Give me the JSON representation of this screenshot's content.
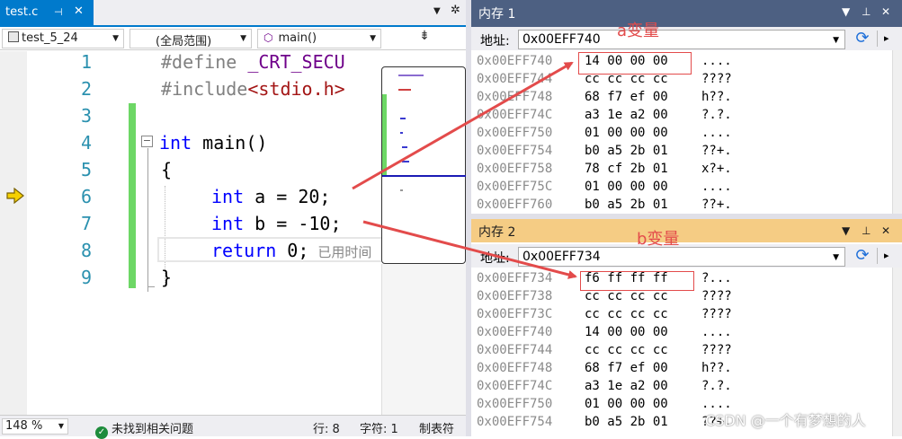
{
  "editor": {
    "tab_label": "test.c",
    "tab_pin": "⊣",
    "tab_close": "✕",
    "nav_project": "test_5_24",
    "nav_scope": "(全局范围)",
    "nav_function": "main()",
    "lines": [
      "1",
      "2",
      "3",
      "4",
      "5",
      "6",
      "7",
      "8",
      "9"
    ],
    "code": {
      "l1_a": "#define ",
      "l1_b": "_CRT_SECU",
      "l2_a": "#include",
      "l2_b": "<stdio.h>",
      "l4_kw": "int",
      "l4_rest": " main()",
      "l5": "{",
      "l6_kw": "int",
      "l6_rest": " a = 20;",
      "l7_kw": "int",
      "l7_rest": " b = -10;",
      "l8_kw": "return",
      "l8_rest": " 0;",
      "l8_hint": "已用时间",
      "l9": "}"
    },
    "collapse_glyph": "−"
  },
  "status": {
    "zoom": "148 %",
    "issues": "未找到相关问题",
    "issues_glyph": "✓",
    "row": "行: 8",
    "col": "字符: 1",
    "tabs": "制表符"
  },
  "memory1": {
    "title": "内存 1",
    "address_label": "地址:",
    "address": "0x00EFF740",
    "rows": [
      {
        "addr": "0x00EFF740",
        "bytes": "14 00 00 00",
        "ascii": "...."
      },
      {
        "addr": "0x00EFF744",
        "bytes": "cc cc cc cc",
        "ascii": "????"
      },
      {
        "addr": "0x00EFF748",
        "bytes": "68 f7 ef 00",
        "ascii": "h??."
      },
      {
        "addr": "0x00EFF74C",
        "bytes": "a3 1e a2 00",
        "ascii": "?.?."
      },
      {
        "addr": "0x00EFF750",
        "bytes": "01 00 00 00",
        "ascii": "...."
      },
      {
        "addr": "0x00EFF754",
        "bytes": "b0 a5 2b 01",
        "ascii": "??+."
      },
      {
        "addr": "0x00EFF758",
        "bytes": "78 cf 2b 01",
        "ascii": "x?+."
      },
      {
        "addr": "0x00EFF75C",
        "bytes": "01 00 00 00",
        "ascii": "...."
      },
      {
        "addr": "0x00EFF760",
        "bytes": "b0 a5 2b 01",
        "ascii": "??+."
      }
    ],
    "annotation": "a变量"
  },
  "memory2": {
    "title": "内存 2",
    "address_label": "地址:",
    "address": "0x00EFF734",
    "rows": [
      {
        "addr": "0x00EFF734",
        "bytes": "f6 ff ff ff",
        "ascii": "?..."
      },
      {
        "addr": "0x00EFF738",
        "bytes": "cc cc cc cc",
        "ascii": "????"
      },
      {
        "addr": "0x00EFF73C",
        "bytes": "cc cc cc cc",
        "ascii": "????"
      },
      {
        "addr": "0x00EFF740",
        "bytes": "14 00 00 00",
        "ascii": "...."
      },
      {
        "addr": "0x00EFF744",
        "bytes": "cc cc cc cc",
        "ascii": "????"
      },
      {
        "addr": "0x00EFF748",
        "bytes": "68 f7 ef 00",
        "ascii": "h??."
      },
      {
        "addr": "0x00EFF74C",
        "bytes": "a3 1e a2 00",
        "ascii": "?.?."
      },
      {
        "addr": "0x00EFF750",
        "bytes": "01 00 00 00",
        "ascii": "...."
      },
      {
        "addr": "0x00EFF754",
        "bytes": "b0 a5 2b 01",
        "ascii": "??+."
      }
    ],
    "annotation": "b变量"
  },
  "watermark": "CSDN @一个有梦想的人",
  "colors": {
    "accent_blue": "#007acc",
    "memory1_title_bg": "#4d6082",
    "memory2_title_bg": "#f5cc84",
    "annotation_red": "#e34b4b",
    "change_bar_green": "#6dd765",
    "exec_arrow_yellow": "#f5d000"
  },
  "icons": {
    "exec_arrow": "current-statement-arrow-icon",
    "refresh": "refresh-icon",
    "split": "split-editor-icon",
    "gear": "gear-icon"
  }
}
